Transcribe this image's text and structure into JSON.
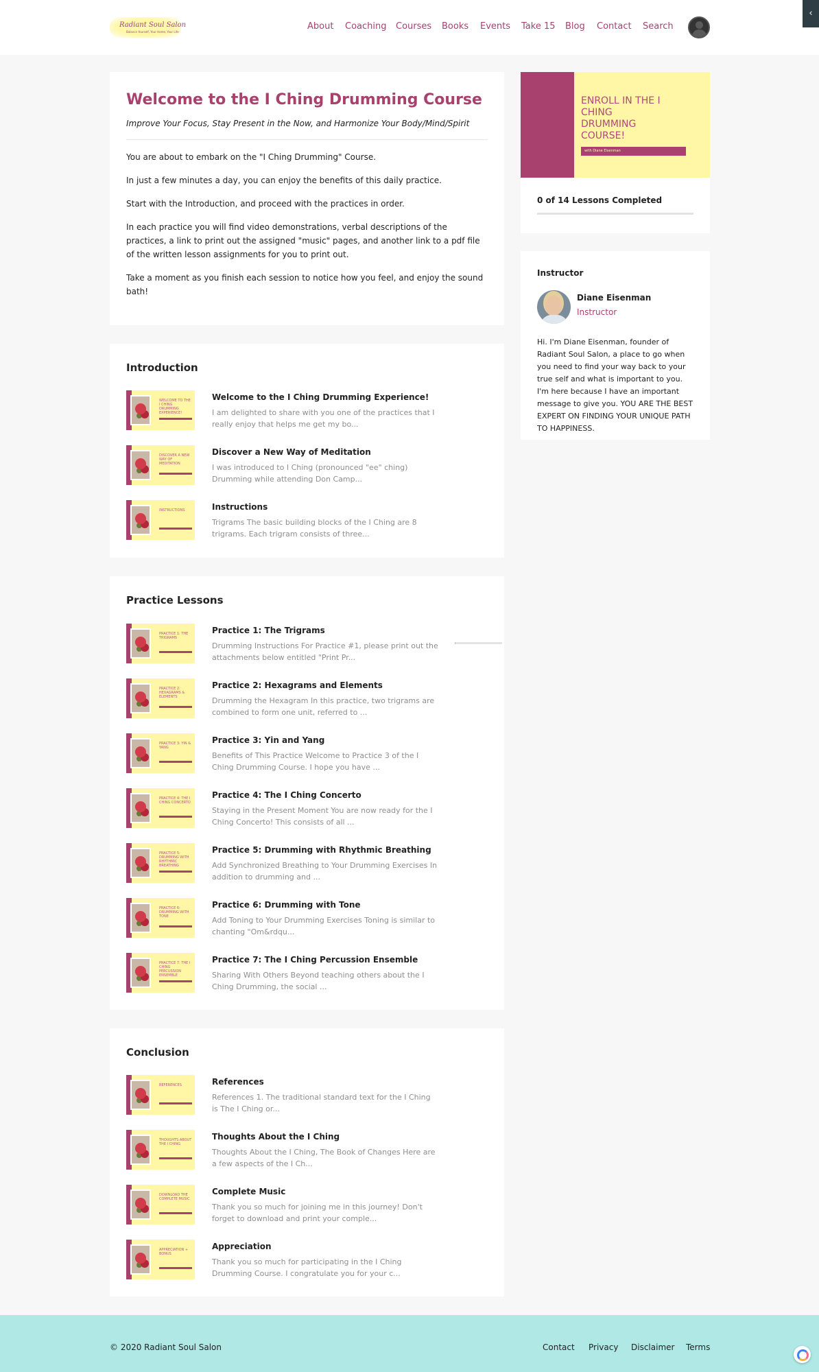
{
  "header": {
    "logo_title": "Radiant Soul Salon",
    "logo_tagline": "Balance Yourself, Your Home, Your Life",
    "nav": [
      {
        "label": "About"
      },
      {
        "label": "Coaching"
      },
      {
        "label": "Courses"
      },
      {
        "label": "Books"
      },
      {
        "label": "Events"
      },
      {
        "label": "Take 15"
      },
      {
        "label": "Blog"
      },
      {
        "label": "Contact"
      },
      {
        "label": "Search"
      }
    ],
    "toggle_icon": "‹"
  },
  "welcome": {
    "title": "Welcome to the I Ching Drumming Course",
    "subtitle": "Improve Your Focus, Stay Present in the Now, and Harmonize Your Body/Mind/Spirit",
    "paragraphs": [
      "You are about to embark on the \"I Ching Drumming\" Course.",
      "In just a few minutes a day, you can enjoy the benefits of this daily practice.",
      "Start with the Introduction, and proceed with the practices in order.",
      "In each practice you will find video demonstrations, verbal descriptions of the practices, a link to print out the assigned \"music\" pages, and another link to a pdf file of the written lesson assignments for you to print out.",
      "Take a moment as you finish each session to notice how you feel, and enjoy the sound bath!"
    ]
  },
  "sections": [
    {
      "title": "Introduction",
      "lessons": [
        {
          "title": "Welcome to the I Ching Drumming Experience!",
          "desc": "I am delighted to share with you one of the practices that I really enjoy that helps me get my bo...",
          "thumb": "WELCOME TO THE I CHING DRUMMING EXPERIENCE!"
        },
        {
          "title": "Discover a New Way of Meditation",
          "desc": "I was introduced to I Ching (pronounced \"ee\" ching) Drumming while attending Don Camp...",
          "thumb": "DISCOVER A NEW WAY OF MEDITATION"
        },
        {
          "title": "Instructions",
          "desc": "Trigrams The basic building blocks of the I Ching are 8 trigrams. Each trigram consists of three...",
          "thumb": "INSTRUCTIONS"
        }
      ]
    },
    {
      "title": "Practice Lessons",
      "lessons": [
        {
          "title": "Practice 1: The Trigrams",
          "desc": "Drumming Instructions For Practice #1, please print out the attachments below entitled \"Print Pr...",
          "thumb": "PRACTICE 1: THE TRIGRAMS",
          "progress": 0.02
        },
        {
          "title": "Practice 2: Hexagrams and Elements",
          "desc": "Drumming the Hexagram In this practice, two trigrams are combined to form one unit, referred to ...",
          "thumb": "PRACTICE 2: HEXAGRAMS & ELEMENTS"
        },
        {
          "title": "Practice 3: Yin and Yang",
          "desc": "Benefits of This Practice Welcome to Practice 3 of the I Ching Drumming Course. I hope you have ...",
          "thumb": "PRACTICE 3: YIN & YANG"
        },
        {
          "title": "Practice 4: The I Ching Concerto",
          "desc": "Staying in the Present Moment You are now ready for the I Ching Concerto! This consists of all ...",
          "thumb": "PRACTICE 4: THE I CHING CONCERTO"
        },
        {
          "title": "Practice 5: Drumming with Rhythmic Breathing",
          "desc": "Add Synchronized Breathing to Your Drumming Exercises In addition to drumming and ...",
          "thumb": "PRACTICE 5: DRUMMING WITH RHYTHMIC BREATHING"
        },
        {
          "title": "Practice 6: Drumming with Tone",
          "desc": "Add Toning to Your Drumming Exercises Toning is similar to chanting \"Om&rdqu...",
          "thumb": "PRACTICE 6: DRUMMING WITH TONE"
        },
        {
          "title": "Practice 7: The I Ching Percussion Ensemble",
          "desc": "Sharing With Others Beyond teaching others about the I Ching Drumming, the social ...",
          "thumb": "PRACTICE 7: THE I CHING PERCUSSION ENSEMBLE"
        }
      ]
    },
    {
      "title": "Conclusion",
      "lessons": [
        {
          "title": "References",
          "desc": "References 1. The traditional standard text for the I Ching is The I Ching or...",
          "thumb": "REFERENCES"
        },
        {
          "title": "Thoughts About the I Ching",
          "desc": "Thoughts About the I Ching, The Book of Changes Here are a few aspects of the I Ch...",
          "thumb": "THOUGHTS ABOUT THE I CHING"
        },
        {
          "title": "Complete Music",
          "desc": "Thank you so much for joining me in this journey! Don't forget to download and print your comple...",
          "thumb": "DOWNLOAD THE COMPLETE MUSIC"
        },
        {
          "title": "Appreciation",
          "desc": "Thank you so much for participating in the I Ching Drumming Course. I congratulate you for your c...",
          "thumb": "APPRECIATION + BONUS"
        }
      ]
    }
  ],
  "sidebar": {
    "enroll_text": "ENROLL IN THE I CHING DRUMMING COURSE!",
    "enroll_byline": "with Diane Eisenman",
    "progress_text": "0 of 14 Lessons Completed",
    "progress_fraction": 0,
    "instructor_heading": "Instructor",
    "instructor_name": "Diane Eisenman",
    "instructor_role": "Instructor",
    "instructor_bio": "Hi. I'm Diane Eisenman, founder of Radiant Soul Salon, a place to go when you need to find your way back to your true self and what is important to you. I'm here because I have an important message to give you. YOU ARE THE BEST EXPERT ON FINDING YOUR UNIQUE PATH TO HAPPINESS."
  },
  "footer": {
    "copyright": "© 2020 Radiant Soul Salon",
    "links": [
      {
        "label": "Contact"
      },
      {
        "label": "Privacy"
      },
      {
        "label": "Disclaimer"
      },
      {
        "label": "Terms"
      }
    ]
  },
  "colors": {
    "accent": "#a8416d",
    "thumb_yellow": "#fff6a6",
    "footer_bg": "#b0e8e6"
  },
  "icons": [
    "chevron-left-icon",
    "user-avatar-icon",
    "chat-bubble-icon"
  ]
}
